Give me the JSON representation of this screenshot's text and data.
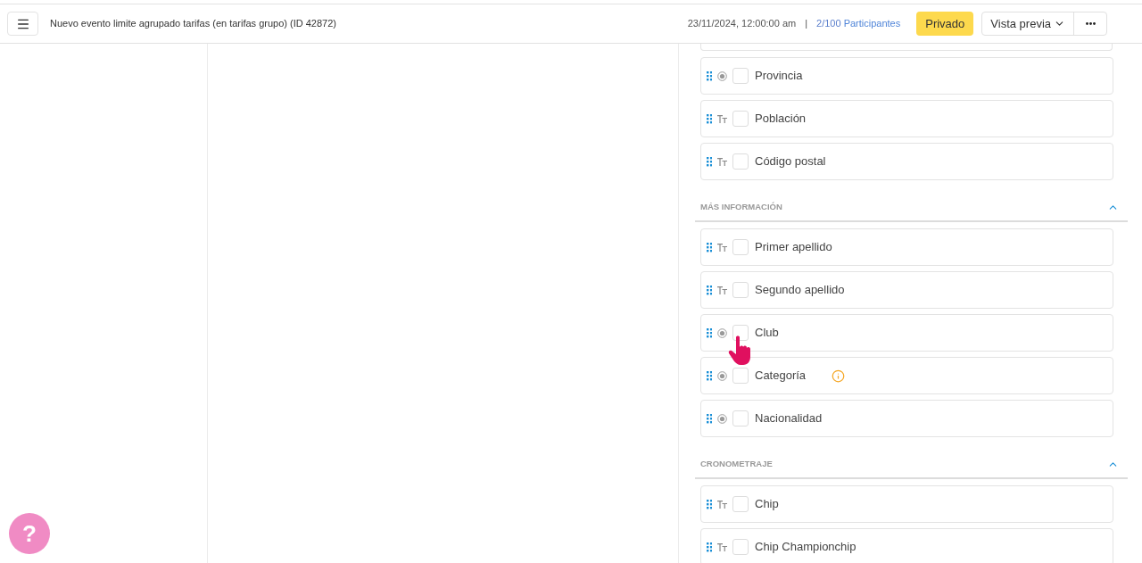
{
  "header": {
    "title": "Nuevo evento limite agrupado tarifas (en tarifas grupo) (ID 42872)",
    "date": "23/11/2024, 12:00:00 am",
    "separator": "|",
    "participants_count": "2/100",
    "participants_label": "Participantes",
    "status_button": "Privado",
    "preview_button": "Vista previa"
  },
  "field_groups": [
    {
      "fields": [
        {
          "label": "Provincia",
          "kind": "choice",
          "checked": false,
          "info": false
        },
        {
          "label": "Población",
          "kind": "text",
          "checked": false,
          "info": false
        },
        {
          "label": "Código postal",
          "kind": "text",
          "checked": false,
          "info": false
        }
      ]
    },
    {
      "title": "MÁS INFORMACIÓN",
      "expanded": true,
      "fields": [
        {
          "label": "Primer apellido",
          "kind": "text",
          "checked": false,
          "info": false
        },
        {
          "label": "Segundo apellido",
          "kind": "text",
          "checked": false,
          "info": false
        },
        {
          "label": "Club",
          "kind": "choice",
          "checked": false,
          "info": false
        },
        {
          "label": "Categoría",
          "kind": "choice",
          "checked": false,
          "info": true
        },
        {
          "label": "Nacionalidad",
          "kind": "choice",
          "checked": false,
          "info": false
        }
      ]
    },
    {
      "title": "CRONOMETRAJE",
      "expanded": true,
      "fields": [
        {
          "label": "Chip",
          "kind": "text",
          "checked": false,
          "info": false
        },
        {
          "label": "Chip Championchip",
          "kind": "text",
          "checked": false,
          "info": false
        }
      ]
    }
  ],
  "help_button": "?"
}
